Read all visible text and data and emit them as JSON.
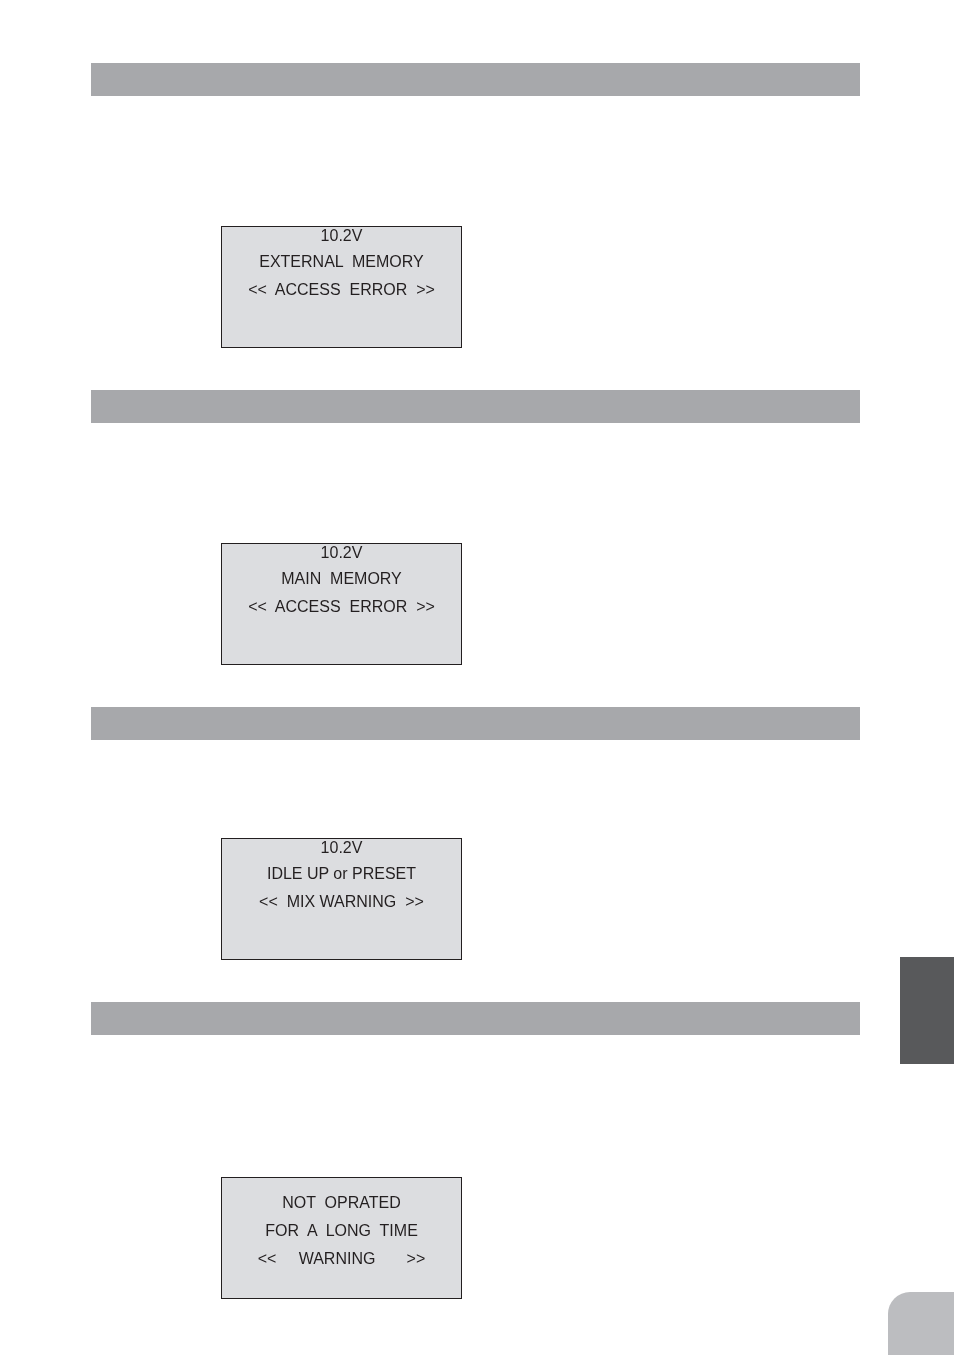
{
  "sections": [
    {
      "screen": {
        "voltage": "10.2V",
        "lines": [
          "EXTERNAL  MEMORY",
          "<<  ACCESS  ERROR  >>"
        ]
      }
    },
    {
      "screen": {
        "voltage": "10.2V",
        "lines": [
          "MAIN  MEMORY",
          "<<  ACCESS  ERROR  >>"
        ]
      }
    },
    {
      "screen": {
        "voltage": "10.2V",
        "lines": [
          "IDLE UP or PRESET",
          "<<  MIX WARNING  >>"
        ]
      }
    },
    {
      "screen": {
        "lines": [
          "NOT  OPRATED",
          "FOR  A  LONG  TIME",
          "<<     WARNING       >>"
        ]
      }
    }
  ]
}
